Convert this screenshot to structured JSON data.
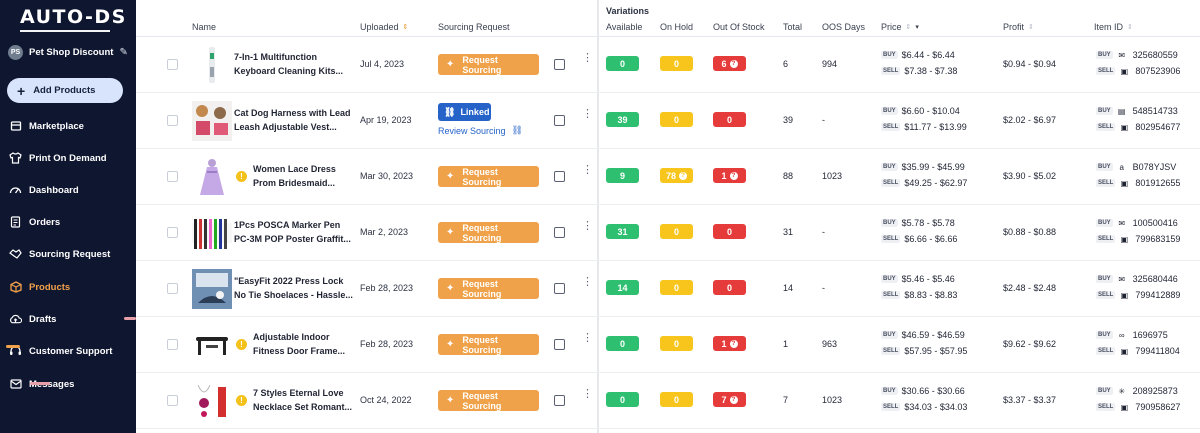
{
  "app": {
    "logo_text": "AUTO-DS"
  },
  "sidebar": {
    "store_initials": "PS",
    "store_name": "Pet Shop Discount",
    "add_products_label": "Add Products",
    "items": [
      {
        "label": "Marketplace",
        "icon": "store-icon"
      },
      {
        "label": "Print On Demand",
        "icon": "shirt-icon"
      },
      {
        "label": "Dashboard",
        "icon": "gauge-icon"
      },
      {
        "label": "Orders",
        "icon": "document-icon"
      },
      {
        "label": "Sourcing Request",
        "icon": "handshake-icon"
      },
      {
        "label": "Products",
        "icon": "box-icon",
        "active": true
      },
      {
        "label": "Drafts",
        "icon": "cloud-upload-icon"
      },
      {
        "label": "Customer Support",
        "icon": "headset-icon"
      },
      {
        "label": "Messages",
        "icon": "envelope-icon"
      }
    ]
  },
  "table": {
    "variations_label": "Variations",
    "headers": {
      "name": "Name",
      "uploaded": "Uploaded",
      "sourcing": "Sourcing Request",
      "available": "Available",
      "on_hold": "On Hold",
      "out_of_stock": "Out Of Stock",
      "total": "Total",
      "oos_days": "OOS Days",
      "price": "Price",
      "profit": "Profit",
      "item_id": "Item ID"
    },
    "tags": {
      "buy": "BUY",
      "sell": "SELL"
    },
    "request_label": "Request Sourcing",
    "linked_label": "Linked",
    "review_label": "Review Sourcing",
    "rows": [
      {
        "name1": "7-In-1 Multifunction",
        "name2": "Keyboard Cleaning Kits...",
        "uploaded": "Jul 4, 2023",
        "sourcing": "request",
        "warn": false,
        "available": "0",
        "on_hold": "0",
        "out_of_stock": "6",
        "total": "6",
        "oos_days": "994",
        "buy": "$6.44 - $6.44",
        "sell": "$7.38 - $7.38",
        "profit": "$0.94 - $0.94",
        "buy_id": "325680559",
        "sell_id": "807523906",
        "buy_icon": "envelope-icon",
        "sell_icon": "bag-icon"
      },
      {
        "name1": "Cat Dog Harness with Lead",
        "name2": "Leash Adjustable Vest...",
        "uploaded": "Apr 19, 2023",
        "sourcing": "linked",
        "warn": false,
        "available": "39",
        "on_hold": "0",
        "out_of_stock": "0",
        "total": "39",
        "oos_days": "-",
        "buy": "$6.60 - $10.04",
        "sell": "$11.77 - $13.99",
        "profit": "$2.02 - $6.97",
        "buy_id": "548514733",
        "sell_id": "802954677",
        "buy_icon": "ds-icon",
        "sell_icon": "bag-icon"
      },
      {
        "name1": "Women Lace Dress",
        "name2": "Prom Bridesmaid...",
        "uploaded": "Mar 30, 2023",
        "sourcing": "request",
        "warn": true,
        "available": "9",
        "on_hold": "78",
        "out_of_stock": "1",
        "total": "88",
        "oos_days": "1023",
        "buy": "$35.99 - $45.99",
        "sell": "$49.25 - $62.97",
        "profit": "$3.90 - $5.02",
        "buy_id": "B078YJSV",
        "sell_id": "801912655",
        "buy_icon": "amazon-icon",
        "sell_icon": "bag-icon"
      },
      {
        "name1": "1Pcs POSCA Marker Pen",
        "name2": "PC-3M POP Poster Graffit...",
        "uploaded": "Mar 2, 2023",
        "sourcing": "request",
        "warn": false,
        "available": "31",
        "on_hold": "0",
        "out_of_stock": "0",
        "total": "31",
        "oos_days": "-",
        "buy": "$5.78 - $5.78",
        "sell": "$6.66 - $6.66",
        "profit": "$0.88 - $0.88",
        "buy_id": "100500416",
        "sell_id": "799683159",
        "buy_icon": "envelope-icon",
        "sell_icon": "bag-icon"
      },
      {
        "name1": "\"EasyFit 2022 Press Lock",
        "name2": "No Tie Shoelaces - Hassle...",
        "uploaded": "Feb 28, 2023",
        "sourcing": "request",
        "warn": false,
        "available": "14",
        "on_hold": "0",
        "out_of_stock": "0",
        "total": "14",
        "oos_days": "-",
        "buy": "$5.46 - $5.46",
        "sell": "$8.83 - $8.83",
        "profit": "$2.48 - $2.48",
        "buy_id": "325680446",
        "sell_id": "799412889",
        "buy_icon": "envelope-icon",
        "sell_icon": "bag-icon"
      },
      {
        "name1": "Adjustable Indoor",
        "name2": "Fitness Door Frame...",
        "uploaded": "Feb 28, 2023",
        "sourcing": "request",
        "warn": true,
        "available": "0",
        "on_hold": "0",
        "out_of_stock": "1",
        "total": "1",
        "oos_days": "963",
        "buy": "$46.59 - $46.59",
        "sell": "$57.95 - $57.95",
        "profit": "$9.62 - $9.62",
        "buy_id": "1696975",
        "sell_id": "799411804",
        "buy_icon": "link-icon",
        "sell_icon": "bag-icon"
      },
      {
        "name1": "7 Styles Eternal Love",
        "name2": "Necklace Set Romant...",
        "uploaded": "Oct 24, 2022",
        "sourcing": "request",
        "warn": true,
        "available": "0",
        "on_hold": "0",
        "out_of_stock": "7",
        "total": "7",
        "oos_days": "1023",
        "buy": "$30.66 - $30.66",
        "sell": "$34.03 - $34.03",
        "profit": "$3.37 - $3.37",
        "buy_id": "208925873",
        "sell_id": "790958627",
        "buy_icon": "sun-icon",
        "sell_icon": "bag-icon"
      }
    ]
  }
}
